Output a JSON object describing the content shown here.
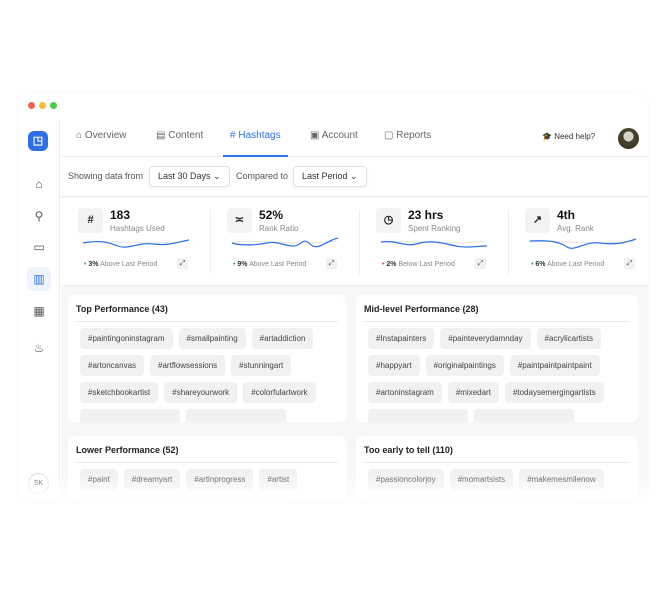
{
  "colors": {
    "accent": "#2f6fe4",
    "positive": "#22a447",
    "negative": "#e0413a"
  },
  "sidebar": {
    "items": [
      {
        "icon": "home-icon"
      },
      {
        "icon": "search-icon"
      },
      {
        "icon": "folder-icon"
      },
      {
        "icon": "chart-icon",
        "active": true
      },
      {
        "icon": "calendar-icon"
      },
      {
        "icon": "fire-icon"
      }
    ],
    "user_initials": "SK"
  },
  "tabs": [
    {
      "label": "Overview",
      "icon": "⌂"
    },
    {
      "label": "Content",
      "icon": "▤"
    },
    {
      "label": "Hashtags",
      "icon": "#",
      "active": true
    },
    {
      "label": "Account",
      "icon": "▣"
    },
    {
      "label": "Reports",
      "icon": "▢"
    }
  ],
  "help": "Need help?",
  "filters": {
    "showing_label": "Showing data from",
    "range": "Last 30 Days",
    "compared_label": "Compared to",
    "compare": "Last Period"
  },
  "stats": [
    {
      "icon": "#",
      "value": "183",
      "label": "Hashtags Used",
      "change": "3%",
      "direction": "Above Last Period",
      "trend": "up"
    },
    {
      "icon": "≍",
      "value": "52%",
      "label": "Rank Ratio",
      "change": "9%",
      "direction": "Above Last Period",
      "trend": "up"
    },
    {
      "icon": "◷",
      "value": "23 hrs",
      "label": "Spent Ranking",
      "change": "2%",
      "direction": "Below Last Period",
      "trend": "down"
    },
    {
      "icon": "↗",
      "value": "4th",
      "label": "Avg. Rank",
      "change": "6%",
      "direction": "Above Last Period",
      "trend": "up"
    }
  ],
  "groups": [
    {
      "title": "Top Performance (43)",
      "tags": [
        "#paintingoninstagram",
        "#smallpainting",
        "#artaddiction",
        "#artoncanvas",
        "#artflowsessions",
        "#stunningart",
        "#sketchbookartist",
        "#shareyourwork",
        "#colorfulartwork"
      ]
    },
    {
      "title": "Mid-level Performance (28)",
      "tags": [
        "#Instapainters",
        "#painteverydamnday",
        "#acrylicartists",
        "#happyart",
        "#originalpaintings",
        "#paintpaintpaintpaint",
        "#artoninstagram",
        "#mixedart",
        "#todaysemergingartists"
      ]
    },
    {
      "title": "Lower Performance (52)",
      "tags": [
        "#paint",
        "#dreamyart",
        "#artinprogress",
        "#artist"
      ]
    },
    {
      "title": "Too early to tell (110)",
      "tags": [
        "#passioncolorjoy",
        "#momartsists",
        "#makemesmilenow"
      ]
    }
  ]
}
